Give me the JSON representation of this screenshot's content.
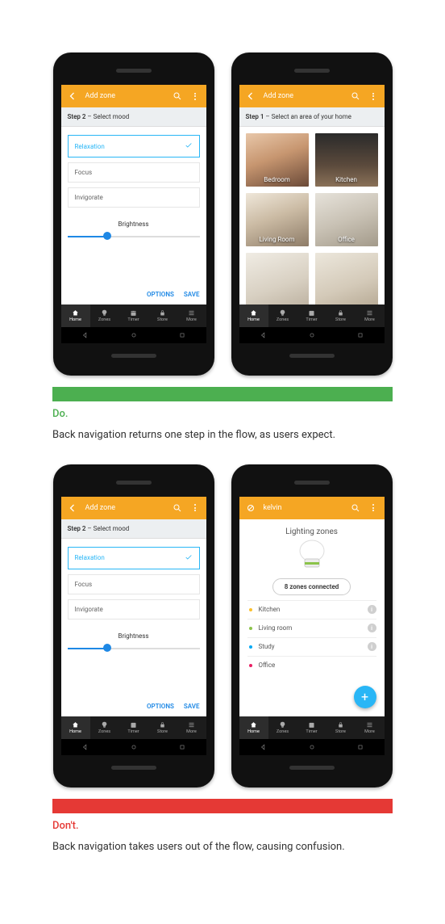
{
  "do": {
    "tag": "Do.",
    "caption": "Back navigation returns one step in the flow, as users expect."
  },
  "dont": {
    "tag": "Don't.",
    "caption": "Back navigation takes users out of the flow, causing confusion."
  },
  "appbar": {
    "title_addzone": "Add zone",
    "title_kelvin": "kelvin"
  },
  "step2": {
    "header_bold": "Step 2",
    "header_rest": " – Select mood",
    "options": [
      "Relaxation",
      "Focus",
      "Invigorate"
    ],
    "brightness_label": "Brightness",
    "actions": {
      "options": "OPTIONS",
      "save": "SAVE"
    },
    "slider_pct": 30
  },
  "step1": {
    "header_bold": "Step 1",
    "header_rest": " – Select an area of your home",
    "tiles": [
      "Bedroom",
      "Kitchen",
      "Living Room",
      "Office"
    ]
  },
  "zones": {
    "title": "Lighting zones",
    "pill": "8 zones connected",
    "items": [
      "Kitchen",
      "Living room",
      "Study",
      "Office"
    ]
  },
  "btmnav": [
    "Home",
    "Zones",
    "Timer",
    "Store",
    "More"
  ]
}
